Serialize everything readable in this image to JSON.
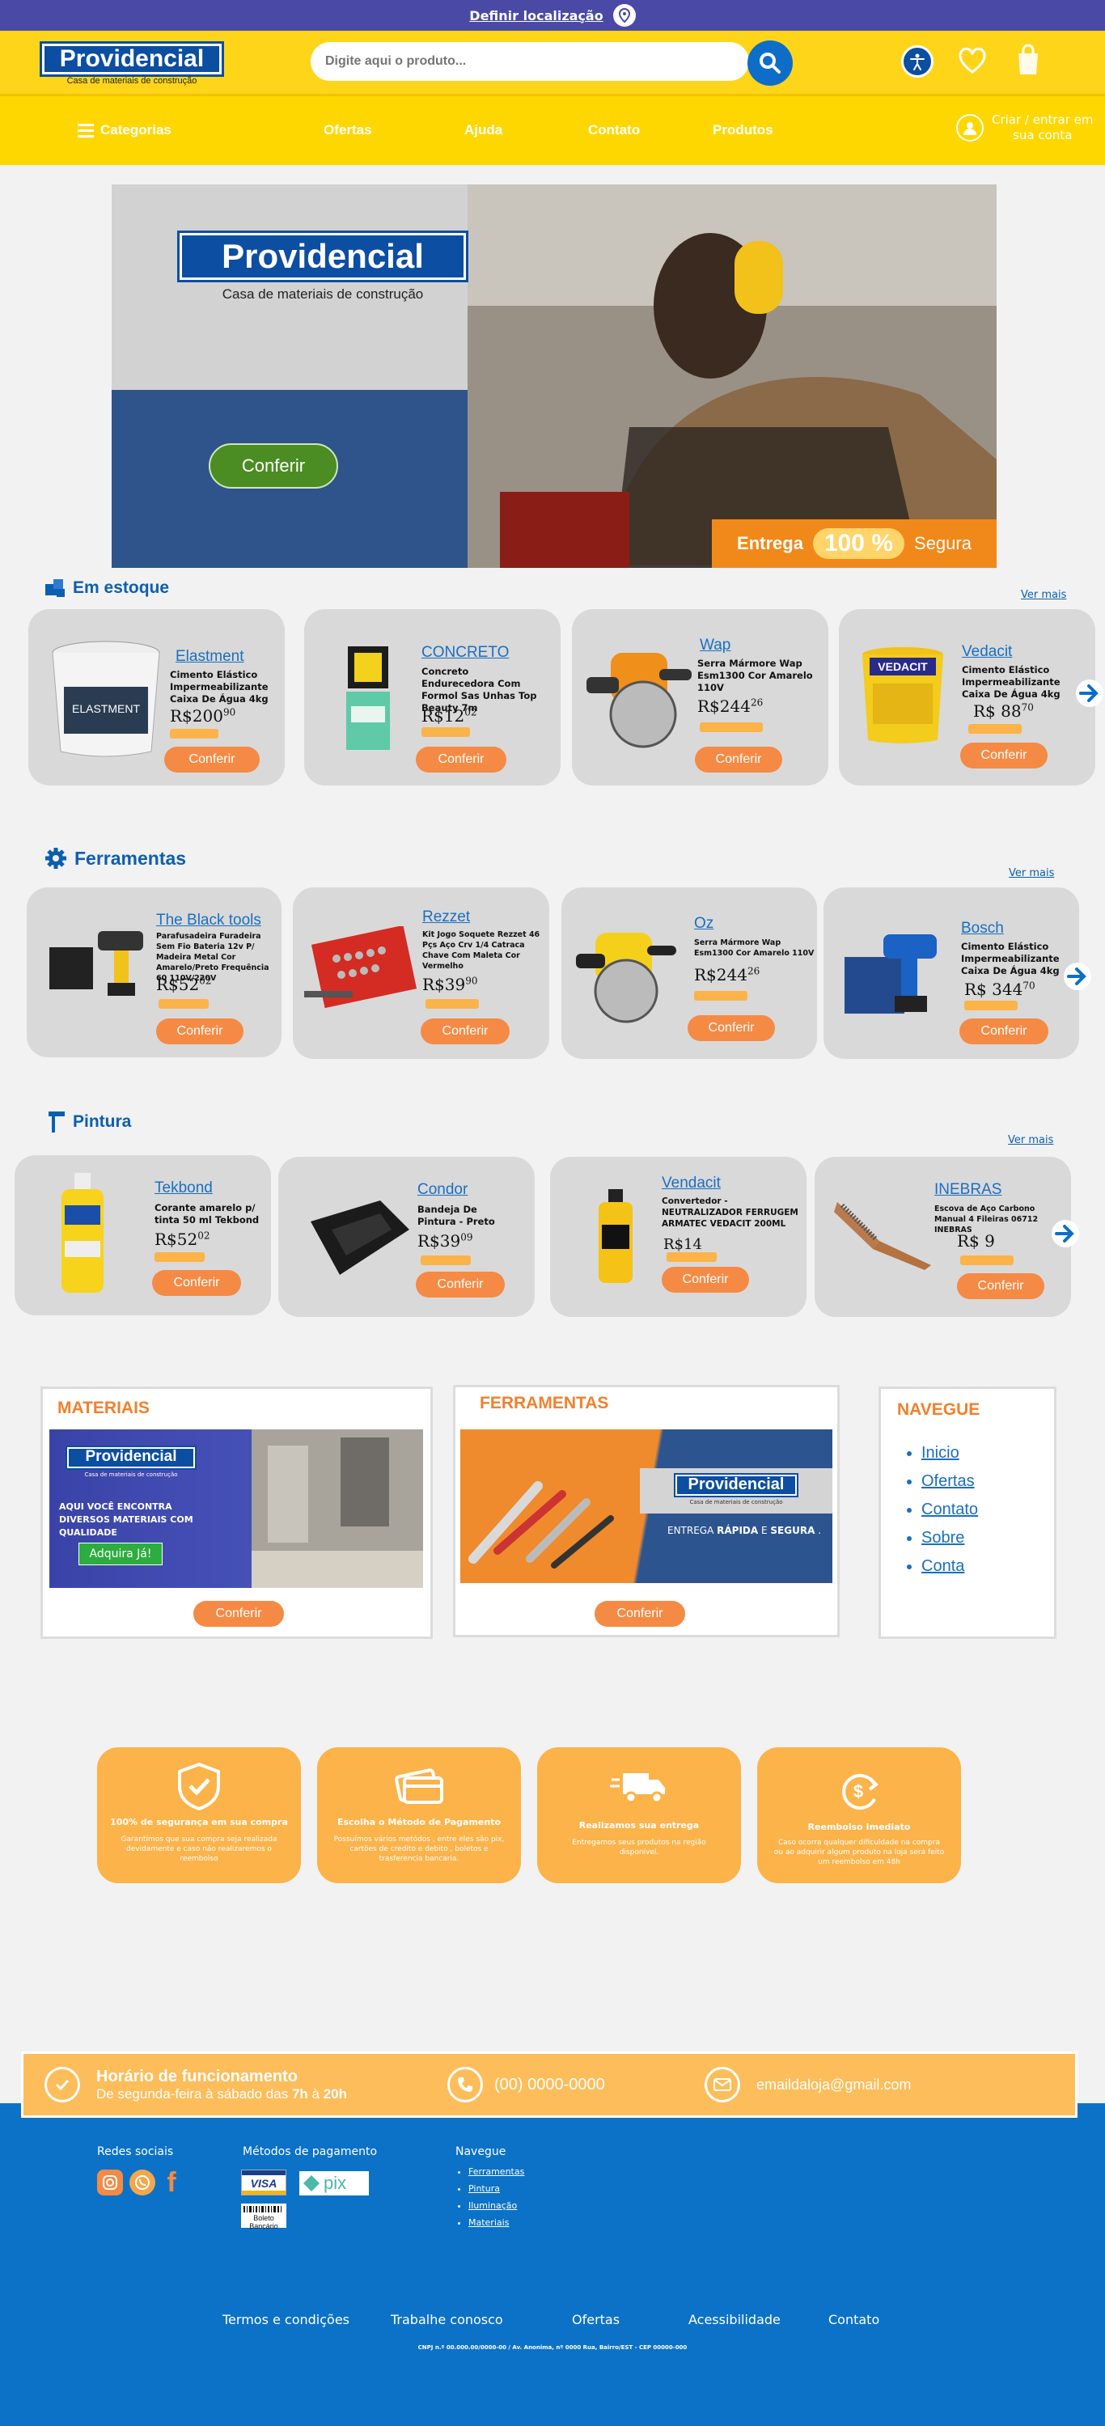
{
  "topbar": {
    "location_label": "Definir localização"
  },
  "header": {
    "logo": "Providencial",
    "logo_sub": "Casa de materiais de construção",
    "search_placeholder": "Digite aqui o produto..."
  },
  "nav": {
    "categories": "Categorias",
    "items": [
      "Ofertas",
      "Ajuda",
      "Contato",
      "Produtos"
    ],
    "login_line1": "Criar / entrar em",
    "login_line2": "sua conta"
  },
  "banner": {
    "logo": "Providencial",
    "subtitle": "Casa de materiais de construção",
    "button": "Conferir",
    "entrega": "Entrega",
    "pct": "100 %",
    "segura": "Segura"
  },
  "sections": [
    {
      "title": "Em estoque",
      "ver_mais": "Ver mais",
      "products": [
        {
          "brand": "Elastment",
          "desc": "Cimento Elástico Impermeabilizante Caixa De Água 4kg",
          "price": "R$200",
          "cents": "90",
          "pix": "",
          "button": "Conferir"
        },
        {
          "brand": "CONCRETO",
          "desc": "Concreto Endurecedora Com Formol Sas Unhas Top Beauty 7m",
          "price": "R$12",
          "cents": "02",
          "pix": "",
          "button": "Conferir"
        },
        {
          "brand": "Wap",
          "desc": "Serra Mármore Wap Esm1300 Cor Amarelo 110V",
          "price": "R$244",
          "cents": "26",
          "pix": "",
          "button": "Conferir"
        },
        {
          "brand": "Vedacit",
          "desc": "Cimento Elástico Impermeabilizante Caixa De Água 4kg",
          "price": "R$ 88",
          "cents": "70",
          "pix": "",
          "button": "Conferir"
        }
      ]
    },
    {
      "title": "Ferramentas",
      "ver_mais": "Ver mais",
      "products": [
        {
          "brand": "The Black tools",
          "desc": "Parafusadeira Furadeira Sem Fio Bateria 12v P/ Madeira Metal Cor Amarelo/Preto Frequência 60 110V/220V",
          "price": "R$52",
          "cents": "02",
          "pix": "",
          "button": "Conferir"
        },
        {
          "brand": "Rezzet",
          "desc": "Kit Jogo Soquete Rezzet 46 Pçs Aço Crv 1/4 Catraca Chave Com Maleta Cor Vermelho",
          "price": "R$39",
          "cents": "90",
          "pix": "",
          "button": "Conferir"
        },
        {
          "brand": "Oz",
          "desc": "Serra Mármore Wap Esm1300 Cor Amarelo 110V",
          "price": "R$244",
          "cents": "26",
          "pix": "",
          "button": "Conferir"
        },
        {
          "brand": "Bosch",
          "desc": "Cimento Elástico Impermeabilizante Caixa De Água 4kg",
          "price": "R$ 344",
          "cents": "70",
          "pix": "",
          "button": "Conferir"
        }
      ]
    },
    {
      "title": "Pintura",
      "ver_mais": "Ver mais",
      "products": [
        {
          "brand": "Tekbond",
          "desc": "Corante amarelo p/ tinta 50 ml Tekbond",
          "price": "R$52",
          "cents": "02",
          "pix": "",
          "button": "Conferir"
        },
        {
          "brand": "Condor",
          "desc": "Bandeja De Pintura - Preto",
          "price": "R$39",
          "cents": "09",
          "pix": "",
          "button": "Conferir"
        },
        {
          "brand": "Vendacit",
          "desc": "Convertedor - NEUTRALIZADOR FERRUGEM ARMATEC VEDACIT 200ML",
          "price": "R$14",
          "cents": "",
          "pix": "",
          "button": "Conferir"
        },
        {
          "brand": "INEBRAS",
          "desc": "Escova de Aço Carbono Manual 4 Fileiras 06712 INEBRAS",
          "price": "R$ 9",
          "cents": "",
          "pix": "",
          "button": "Conferir"
        }
      ]
    }
  ],
  "panels": {
    "materiais": {
      "title": "MATERIAIS",
      "logo": "Providencial",
      "logo_sub": "Casa de materiais de construção",
      "text": "AQUI VOCÊ ENCONTRA DIVERSOS MATERIAIS COM QUALIDADE",
      "cta": "Adquira Já!",
      "button": "Conferir"
    },
    "ferramentas": {
      "title": "FERRAMENTAS",
      "logo": "Providencial",
      "logo_sub": "Casa de materiais de construção",
      "text_a": "ENTREGA ",
      "text_b": "RÁPIDA",
      "text_c": " E ",
      "text_d": "SEGURA",
      "text_e": " .",
      "button": "Conferir"
    },
    "navegue": {
      "title": "NAVEGUE",
      "items": [
        "Inicio",
        "Ofertas",
        "Contato",
        "Sobre",
        "Conta"
      ]
    }
  },
  "features": [
    {
      "icon": "shield-check-icon",
      "title": "100% de segurança em sua compra",
      "desc": "Garantimos que sua compra seja realizada devidamente e caso não realizaremos o reembolso"
    },
    {
      "icon": "credit-card-icon",
      "title": "Escolha o Método de Pagamento",
      "desc": "Possuímos vários metódos , entre eles são pix, cartões de credito e debito , boletos e trasferencia bancaria."
    },
    {
      "icon": "delivery-truck-icon",
      "title": "Realizamos sua entrega",
      "desc": "Entregamos seus produtos na região disponível."
    },
    {
      "icon": "refund-icon",
      "title": "Reembolso Imediato",
      "desc": "Caso ocorra qualquer dificuldade na compra ou ao adquirir algum produto na loja será feito um reembolso em 48h"
    }
  ],
  "hours": {
    "title": "Horário de funcionamento",
    "sub_a": "De segunda-feira à sábado das ",
    "sub_b": "7h",
    "sub_c": " à ",
    "sub_d": "20h",
    "phone": "(00) 0000-0000",
    "email": "emaildaloja@gmail.com"
  },
  "footer": {
    "social_title": "Redes sociais",
    "payment_title": "Métodos de pagamento",
    "visa": "VISA",
    "pix": "pix",
    "boleto": "Boleto Bancário",
    "navegue_title": "Navegue",
    "navegue_items": [
      "Ferramentas",
      "Pintura",
      "Iluminação",
      "Materiais"
    ],
    "bottom_links": [
      "Termos e condições",
      "Trabalhe conosco",
      "Ofertas",
      "Acessibilidade",
      "Contato"
    ],
    "cnpj": "CNPJ n.º 00.000.00/0000-00 / Av. Anonima, nº 0000 Rua, Bairro/EST - CEP 00000-000"
  },
  "colors": {
    "brand_blue": "#0c4ea2",
    "yellow": "#ffd700",
    "orange": "#f58a45",
    "footer_blue": "#0c72c7",
    "topbar": "#4a4aa6"
  }
}
